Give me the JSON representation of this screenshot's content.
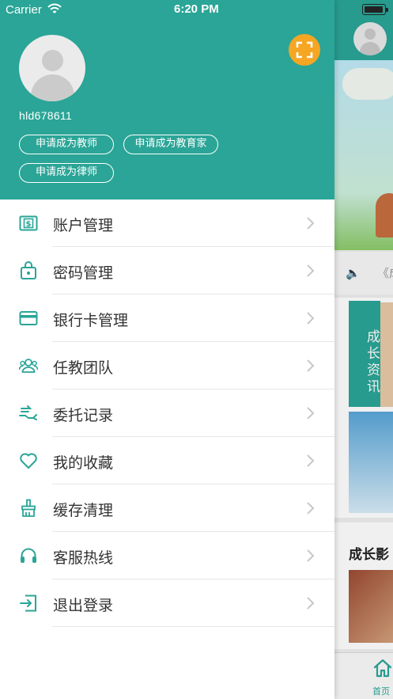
{
  "status_bar": {
    "carrier": "Carrier",
    "time": "6:20 PM"
  },
  "profile": {
    "username": "hld678611",
    "apply_buttons": [
      "申请成为教师",
      "申请成为教育家",
      "申请成为律师"
    ]
  },
  "menu": [
    {
      "label": "账户管理",
      "icon": "dollar-card-icon"
    },
    {
      "label": "密码管理",
      "icon": "lock-icon"
    },
    {
      "label": "银行卡管理",
      "icon": "bank-card-icon"
    },
    {
      "label": "任教团队",
      "icon": "team-icon"
    },
    {
      "label": "委托记录",
      "icon": "hand-entrust-icon"
    },
    {
      "label": "我的收藏",
      "icon": "heart-icon"
    },
    {
      "label": "缓存清理",
      "icon": "broom-icon"
    },
    {
      "label": "客服热线",
      "icon": "headset-icon"
    },
    {
      "label": "退出登录",
      "icon": "logout-icon"
    }
  ],
  "background_app": {
    "notice_text": "《成",
    "news_tag": "成长资讯",
    "section_title": "成长影",
    "tab_home": "首页"
  },
  "colors": {
    "primary": "#2aa597",
    "scan_button": "#f5a623"
  }
}
